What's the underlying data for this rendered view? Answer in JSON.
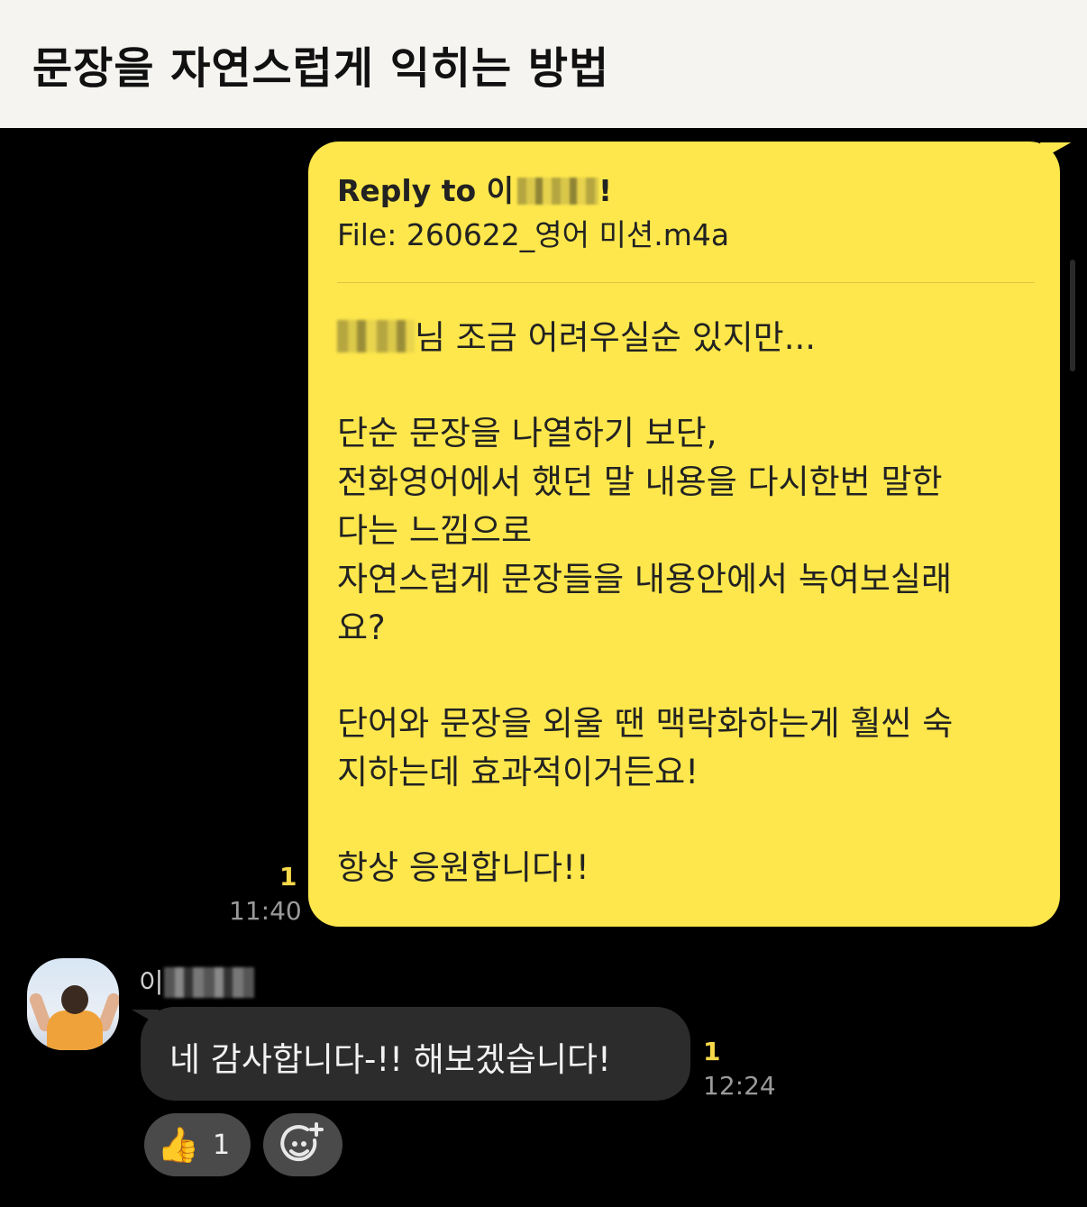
{
  "header": {
    "title": "문장을 자연스럽게 익히는 방법"
  },
  "outgoing": {
    "reply_label": "Reply to 이",
    "reply_suffix": "!",
    "file_line": "File: 260622_영어 미션.m4a",
    "lines": [
      "님 조금 어려우실순 있지만...",
      "",
      "단순 문장을 나열하기 보단,",
      "전화영어에서 했던 말 내용을 다시한번 말한",
      "다는 느낌으로",
      "자연스럽게 문장들을 내용안에서 녹여보실래",
      "요?",
      "",
      "단어와 문장을 외울 땐 맥락화하는게 훨씬 숙",
      "지하는데 효과적이거든요!",
      "",
      "항상 응원합니다!!"
    ],
    "read_count": "1",
    "time": "11:40"
  },
  "incoming": {
    "sender": "이",
    "text": "네 감사합니다-!! 해보겠습니다!",
    "read_count": "1",
    "time": "12:24",
    "reaction_count": "1",
    "reaction_icon": "thumbs-up-icon"
  },
  "colors": {
    "outgoing_bubble": "#fde74c",
    "incoming_bubble": "#2c2c2c",
    "background": "#000000",
    "read_indicator": "#f7d94a"
  }
}
